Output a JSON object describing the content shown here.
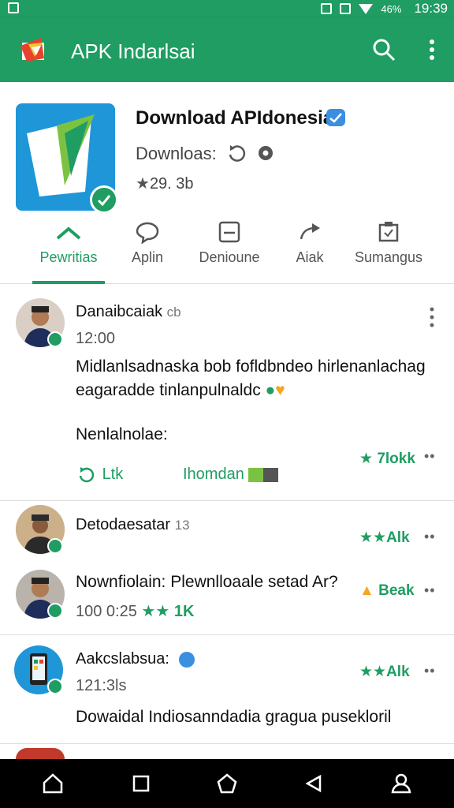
{
  "status_bar": {
    "battery": "46%",
    "time": "19:39"
  },
  "app_bar": {
    "title": "APK Indarlsai",
    "icons": [
      "app-logo-icon",
      "search-icon",
      "more-vert-icon"
    ]
  },
  "app_header": {
    "name": "Download APIdonesia",
    "downloads_label": "Downloas:",
    "rating": "29. 3b"
  },
  "tabs": [
    {
      "label": "Pewritias",
      "icon": "chevron-up-icon",
      "active": true
    },
    {
      "label": "Aplin",
      "icon": "chat-bubble-icon"
    },
    {
      "label": "Denioune",
      "icon": "window-icon"
    },
    {
      "label": "Aiak",
      "icon": "share-arrow-icon"
    },
    {
      "label": "Sumangus",
      "icon": "clipboard-icon"
    }
  ],
  "posts": [
    {
      "user": "Danaibcaiak",
      "user_suffix": "cb",
      "time": "12:00",
      "text_line1": "Midlanlsadnaska bob fofldbndeo hirlenanlachag",
      "text_line2": "eagaradde tinlanpulnaldc",
      "text_line3": "Nenlalnolae:",
      "rating": "7lokk",
      "like_label": "Ltk",
      "download_label": "Ihomdan"
    },
    {
      "user": "Detodaesatar",
      "user_suffix": "13",
      "rating": "Alk"
    },
    {
      "user": "Nownfiolain: Plewnlloaale setad Ar?",
      "sub": "100 0:25",
      "sub_rating": "1K",
      "rating": "Beak"
    },
    {
      "user": "Aakcslabsua:",
      "sub": "121:3ls",
      "text": "Dowaidal Indiosanndadia gragua pusekloril",
      "rating": "Alk"
    }
  ],
  "colors": {
    "primary": "#1f9d62",
    "accent_blue": "#1e96d8",
    "verified": "#3b8fe0"
  }
}
